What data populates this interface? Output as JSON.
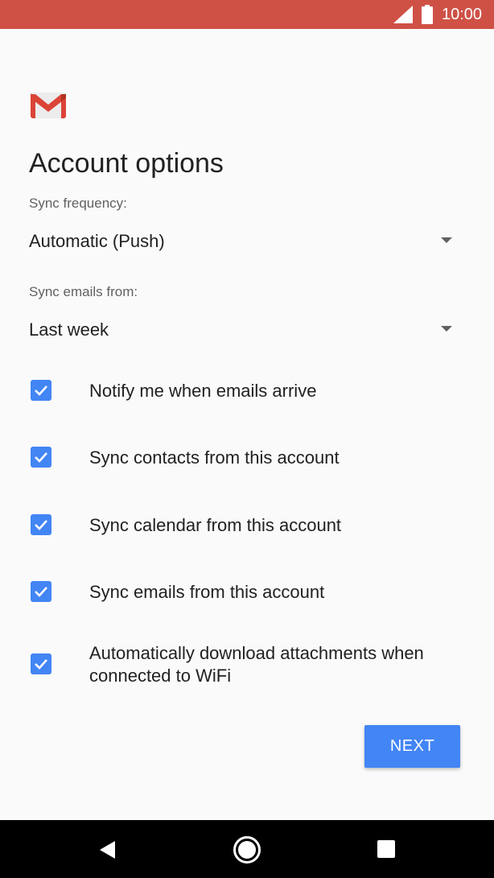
{
  "status_bar": {
    "time": "10:00",
    "background": "#cf5146",
    "icons": [
      "signal-icon",
      "battery-icon"
    ]
  },
  "app": {
    "logo": "gmail-logo",
    "title": "Account options"
  },
  "sync_frequency": {
    "label": "Sync frequency:",
    "value": "Automatic (Push)"
  },
  "sync_emails_from": {
    "label": "Sync emails from:",
    "value": "Last week"
  },
  "options": [
    {
      "label": "Notify me when emails arrive",
      "checked": true
    },
    {
      "label": "Sync contacts from this account",
      "checked": true
    },
    {
      "label": "Sync calendar from this account",
      "checked": true
    },
    {
      "label": "Sync emails from this account",
      "checked": true
    },
    {
      "label": "Automatically download attachments when connected to WiFi",
      "checked": true
    }
  ],
  "next_button": {
    "label": "NEXT"
  },
  "nav_bar": {
    "icons": [
      "back-icon",
      "home-icon",
      "recents-icon"
    ]
  },
  "colors": {
    "accent": "#4285f4",
    "status_bar": "#cf5146",
    "background": "#fafafa"
  }
}
